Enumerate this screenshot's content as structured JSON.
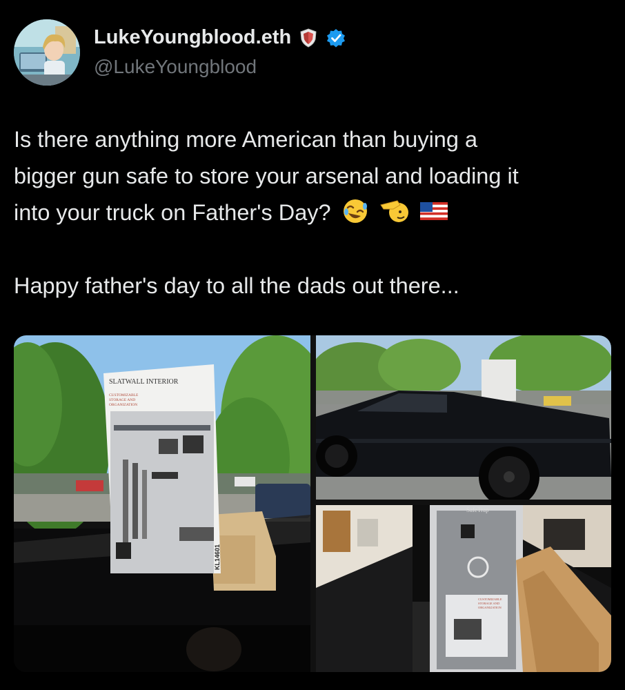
{
  "author": {
    "display_name": "LukeYoungblood.eth",
    "handle": "@LukeYoungblood",
    "avatar_icon": "anime-avatar-icon",
    "shield_badge_icon": "shield-badge-icon",
    "verified_icon": "verified-badge-icon",
    "verified_color": "#1d9bf0"
  },
  "tweet": {
    "line1": "Is there anything more American than buying a",
    "line2": "bigger gun safe to store your arsenal and loading it",
    "line3": "into your truck on Father's Day?",
    "line3_emojis": [
      "rolling-on-floor-laughing-emoji",
      "saluting-face-emoji",
      "us-flag-emoji"
    ],
    "line4": "Happy father's day to all the dads out there..."
  },
  "media": {
    "image1": {
      "description_icon": "slatwall-box-in-truck-photo",
      "box_title": "SLATWALL INTERIOR",
      "box_subtitle1": "CUSTOMIZABLE",
      "box_subtitle2": "STORAGE AND",
      "box_subtitle3": "ORGANIZATION",
      "side_box_code": "KL14601"
    },
    "image2": {
      "description_icon": "black-cybertruck-photo"
    },
    "image3": {
      "description_icon": "gun-safe-in-truck-bed-photo",
      "safe_brand": "SafeTrap",
      "safe_box_text1": "CUSTOMIZABLE",
      "safe_box_text2": "STORAGE AND",
      "safe_box_text3": "ORGANIZATION"
    }
  }
}
